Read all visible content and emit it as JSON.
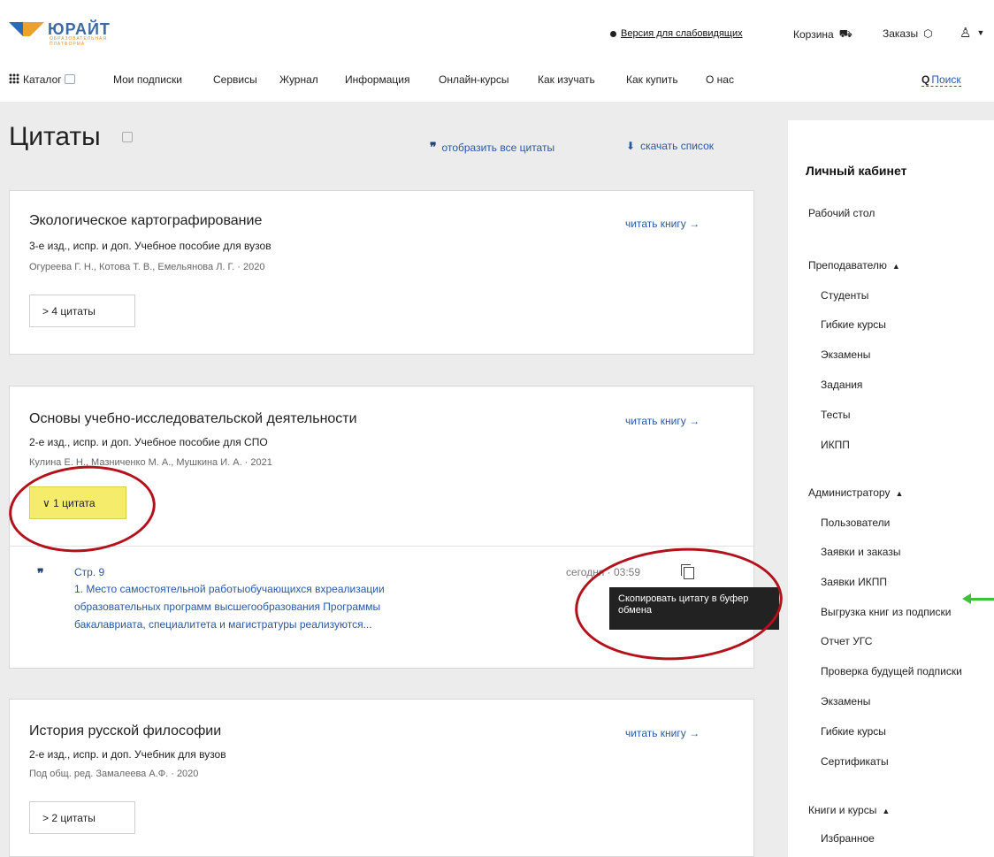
{
  "header": {
    "logo_name": "ЮРАЙТ",
    "logo_subtitle": "ОБРАЗОВАТЕЛЬНАЯ ПЛАТФОРМА",
    "accessibility_link": "Версия для слабовидящих",
    "cart_label": "Корзина",
    "orders_label": "Заказы"
  },
  "nav": {
    "catalog": "Каталог",
    "items": [
      "Мои подписки",
      "Сервисы",
      "Журнал",
      "Информация",
      "Онлайн-курсы",
      "Как изучать",
      "Как купить",
      "О нас"
    ],
    "search": "Поиск"
  },
  "page": {
    "title": "Цитаты",
    "show_all": "отобразить все цитаты",
    "download": "скачать список"
  },
  "books": [
    {
      "title": "Экологическое картографирование",
      "edition": "3-е изд., испр. и доп. Учебное пособие для вузов",
      "authors": "Огуреева Г. Н., Котова Т. В., Емельянова Л. Г. · 2020",
      "read": "читать книгу →",
      "quotes_button": "> 4 цитаты"
    },
    {
      "title": "Основы учебно-исследовательской деятельности",
      "edition": "2-е изд., испр. и доп. Учебное пособие для СПО",
      "authors": "Кулина Е. Н., Мазниченко М. А., Мушкина И. А. · 2021",
      "read": "читать книгу →",
      "quotes_button": "∨ 1 цитата",
      "quote": {
        "page": "Стр. 9",
        "text": "1. Место самостоятельной работыобучающихся вхреализации образовательных программ высшегообразования Программы бакалавриата, специалитета и магистратуры реализуются...",
        "time": "сегодня · 03:59",
        "tooltip": "Скопировать цитату в буфер обмена"
      }
    },
    {
      "title": "История русской философии",
      "edition": "2-е изд., испр. и доп. Учебник для вузов",
      "authors": "Под общ. ред. Замалеева А.Ф. · 2020",
      "read": "читать книгу →",
      "quotes_button": "> 2 цитаты"
    }
  ],
  "sidebar": {
    "title": "Личный кабинет",
    "desk": "Рабочий стол",
    "teacher": "Преподавателю",
    "teacher_items": [
      "Студенты",
      "Гибкие курсы",
      "Экзамены",
      "Задания",
      "Тесты",
      "ИКПП"
    ],
    "admin": "Администратору",
    "admin_items": [
      "Пользователи",
      "Заявки и заказы",
      "Заявки ИКПП",
      "Выгрузка книг из подписки",
      "Отчет УГС",
      "Проверка будущей подписки",
      "Экзамены",
      "Гибкие курсы",
      "Сертификаты"
    ],
    "books": "Книги и курсы",
    "books_items": [
      "Избранное"
    ]
  },
  "colors": {
    "link": "#2a58a0",
    "highlight": "#f6ec6b",
    "annotation_red": "#b3111b",
    "annotation_green": "#3bc236"
  }
}
